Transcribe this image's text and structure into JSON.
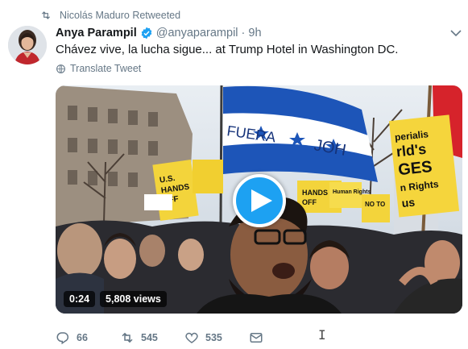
{
  "retweet_context": {
    "label": "Nicolás Maduro Retweeted",
    "icon": "retweet-icon"
  },
  "tweet": {
    "author_name": "Anya Parampil",
    "verified": true,
    "handle": "@anyaparampil",
    "separator": "·",
    "timestamp": "9h",
    "text": "Chávez vive, la lucha sigue... at Trump Hotel in Washington DC.",
    "translate_label": "Translate Tweet"
  },
  "video": {
    "duration": "0:24",
    "views": "5,808 views",
    "flag_text_1": "FUERA",
    "flag_text_2": "JOH",
    "sign_1": "U.S. HANDS OFF VENEZUELA",
    "sign_2": "HANDS OFF VENEZUELA",
    "sign_3": "Human Rights abuser",
    "sign_4": "HANDS OFF",
    "sign_5": "IMPERIALISM is the World's BIGGEST US",
    "sign_6": "NO TO",
    "sign_7": "Human Rights"
  },
  "actions": {
    "reply_count": "66",
    "retweet_count": "545",
    "like_count": "535"
  },
  "colors": {
    "accent": "#1da1f2",
    "muted": "#657786",
    "text": "#14171a"
  }
}
